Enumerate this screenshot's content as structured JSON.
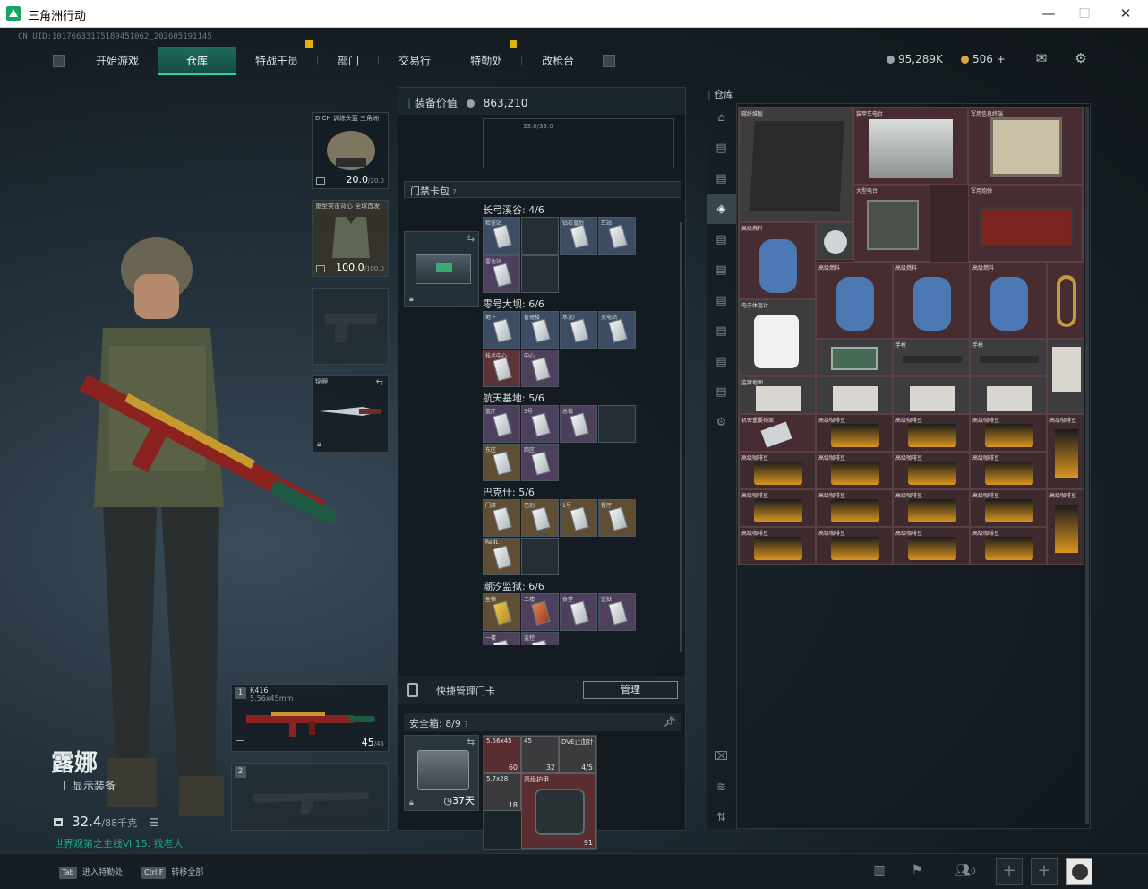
{
  "window": {
    "title": "三角洲行动",
    "minimize": "—",
    "maximize": "☐",
    "close": "✕"
  },
  "uid": "CN UID:10176633175189451062_202605191145",
  "nav": {
    "tabs": [
      {
        "label": "开始游戏"
      },
      {
        "label": "仓库",
        "active": true
      },
      {
        "label": "特战干员",
        "badge": true
      },
      {
        "label": "部门"
      },
      {
        "label": "交易行"
      },
      {
        "label": "特勤处",
        "badge": true
      },
      {
        "label": "改枪台"
      }
    ]
  },
  "currency": {
    "hafcoin": "95,289K",
    "coupons": "506",
    "plus": "+"
  },
  "colors": {
    "accent": "#31d39a",
    "tab_active": "#1e6b5c",
    "warehouse_bg": "#3a2529",
    "mission": "#1fa57f"
  },
  "character": {
    "name": "露娜",
    "show_gear": "显示装备",
    "weight": "32.4",
    "weight_max": "/88千克",
    "mission": "世界观第之主线Ⅵ 15. 找老大"
  },
  "slots": {
    "helmet": {
      "label": "DICH 训练头盔 三角洲",
      "value": "20.0",
      "max": "/20.0"
    },
    "armor": {
      "label": "重型突击背心 全球首发",
      "value": "100.0",
      "max": "/100.0"
    },
    "knife": {
      "label": "锦鲤"
    },
    "primary": {
      "num": "1",
      "name": "K416",
      "caliber": "5.56x45mm",
      "ammo": "45",
      "ammo_max": "/45"
    },
    "secondary": {
      "num": "2"
    }
  },
  "middle": {
    "equip_value_label": "装备价值",
    "equip_value": "863,210",
    "capacity": "33.0/33.0",
    "keycase_title": "门禁卡包",
    "regions": [
      {
        "title": "长弓溪谷: 4/6",
        "cards": [
          "检查站",
          "",
          "钻石皇后",
          "车站",
          "雷达站"
        ]
      },
      {
        "title": "零号大坝: 6/6",
        "cards": [
          "地下",
          "管理楼",
          "水泥厂",
          "变电站",
          "技术中心",
          "中心"
        ]
      },
      {
        "title": "航天基地: 5/6",
        "cards": [
          "蓝厅",
          "3号",
          "总裁",
          "",
          "东区",
          "西区"
        ]
      },
      {
        "title": "巴克什: 5/6",
        "cards": [
          "门店",
          "巴别",
          "1号",
          "餐厅",
          "RedL"
        ]
      },
      {
        "title": "潮汐监狱: 6/6",
        "cards": [
          "生物",
          "二楼",
          "食堂",
          "监狱",
          "一楼",
          "监控"
        ]
      }
    ],
    "quick_manage": "快捷管理门卡",
    "manage_btn": "管理",
    "safe_title": "安全箱: 8/9",
    "safe_days": "37天",
    "safe_items": [
      {
        "name": "5.56x45",
        "qty": "60"
      },
      {
        "name": "45",
        "qty": "32"
      },
      {
        "name": "DVE止血针",
        "qty": "4/5"
      },
      {
        "name": "5.7x28",
        "qty": "18"
      },
      {
        "name": "高级护甲",
        "qty": "91"
      }
    ]
  },
  "warehouse": {
    "label": "仓库",
    "items": [
      {
        "name": "碳纤维板"
      },
      {
        "name": "装甲车电台"
      },
      {
        "name": "军用信息终端"
      },
      {
        "name": "大型电台"
      },
      {
        "name": "军用炮弹"
      },
      {
        "name": "高级燃料"
      },
      {
        "name": "电子体温计"
      },
      {
        "name": "手枪"
      },
      {
        "name": "高级咖啡豆"
      },
      {
        "name": "监狱地图"
      },
      {
        "name": "机密重要档案"
      }
    ]
  },
  "bottom": {
    "hint1_key": "Tab",
    "hint1": "进入特勤处",
    "hint2_key": "Ctrl F",
    "hint2": "转移全部",
    "friends": "0"
  }
}
